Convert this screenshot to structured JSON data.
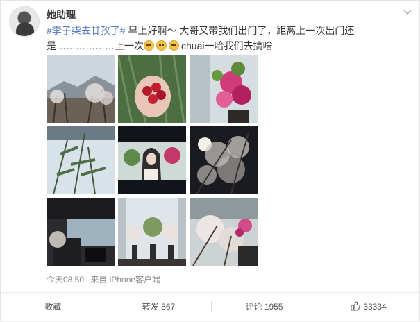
{
  "user": {
    "name": "她助理"
  },
  "post": {
    "topic": "#李子柒去甘孜了#",
    "text_1": " 早上好啊～ 大哥又带我们出门了，距离上一次出门还是………………上一次",
    "text_2": "chuai一哈我们去搞啥"
  },
  "meta": {
    "time": "今天08:50",
    "source": "来自 iPhone客户端"
  },
  "actions": {
    "favorite": "收藏",
    "repost": "转发 867",
    "comment": "评论 1955",
    "like": "33334"
  },
  "photos": [
    {
      "name": "photo-mountain-blossom"
    },
    {
      "name": "photo-hand-cherries"
    },
    {
      "name": "photo-pink-flowers"
    },
    {
      "name": "photo-bamboo-window"
    },
    {
      "name": "photo-girl-video"
    },
    {
      "name": "photo-night-blossom"
    },
    {
      "name": "photo-office-room"
    },
    {
      "name": "photo-flowers-window"
    },
    {
      "name": "photo-blossom-branches"
    }
  ],
  "icons": {
    "more": "chevron-down-icon",
    "like": "thumbs-up-icon",
    "emoji": "cute-face-emoji"
  }
}
